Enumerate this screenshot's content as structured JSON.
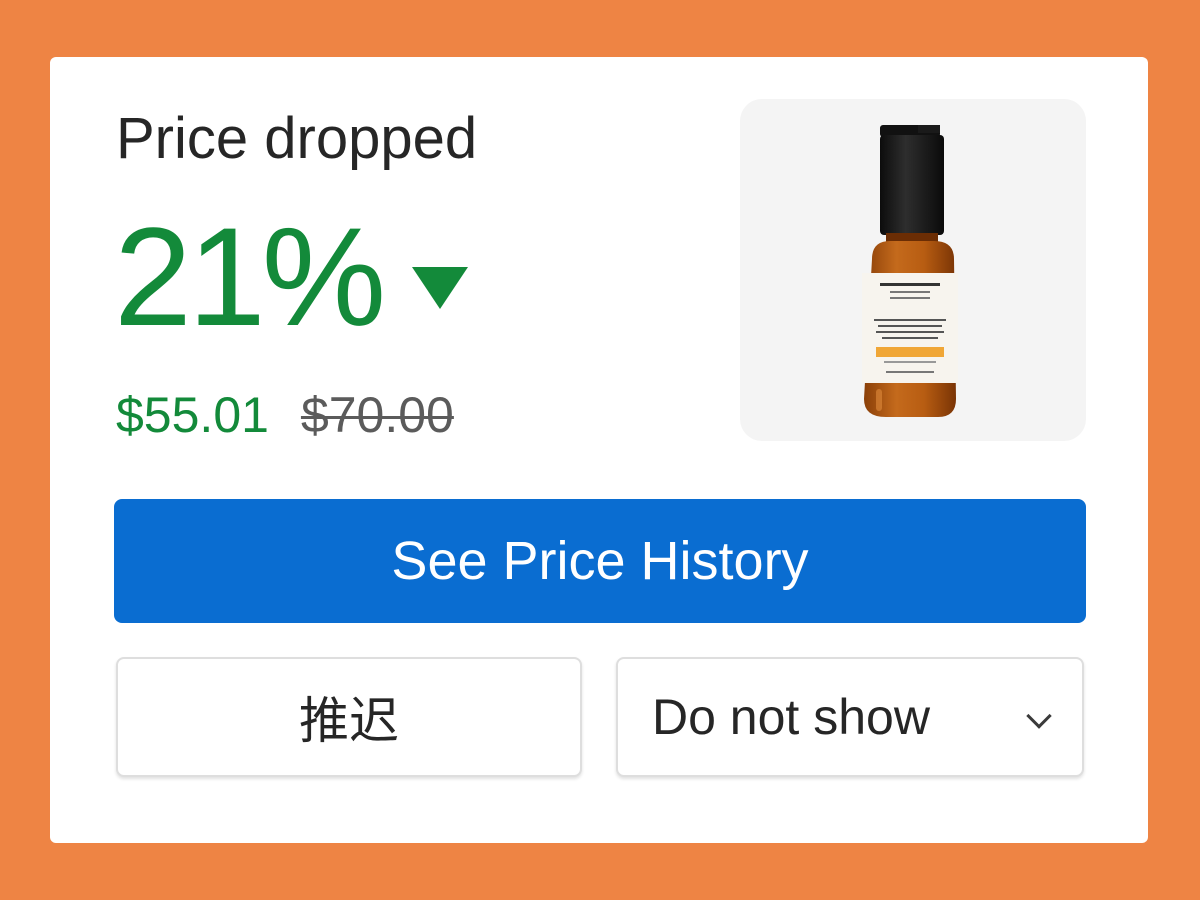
{
  "popup": {
    "title": "Price dropped",
    "drop_percent": "21%",
    "current_price": "$55.01",
    "original_price": "$70.00",
    "primary_button_label": "See Price History",
    "snooze_button_label": "推迟",
    "dropdown_selected": "Do not show"
  },
  "icons": {
    "drop_indicator": "triangle-down-icon",
    "dropdown_chevron": "chevron-down-icon"
  },
  "colors": {
    "frame_background": "#EE8444",
    "accent_green": "#138A3A",
    "primary_button": "#0A6DD1",
    "card_background": "#FFFFFF",
    "image_background": "#F4F4F4"
  }
}
